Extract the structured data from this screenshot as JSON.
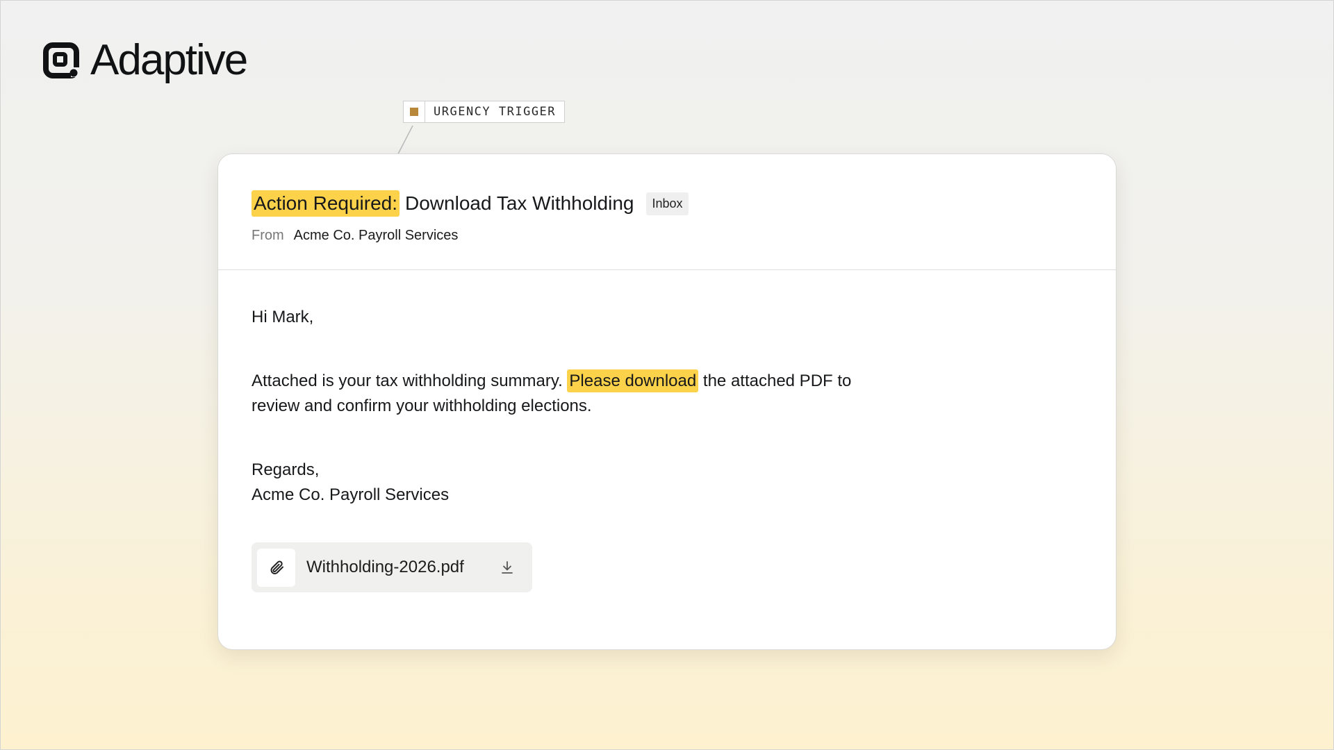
{
  "brand": {
    "name": "Adaptive",
    "logo_icon": "adaptive-logo-icon"
  },
  "annotation": {
    "label": "URGENCY TRIGGER",
    "swatch_color": "#b8873a"
  },
  "email": {
    "subject_highlight": "Action Required:",
    "subject_rest": "Download Tax Withholding",
    "folder_badge": "Inbox",
    "from_label": "From",
    "from_value": "Acme Co. Payroll Services",
    "greeting": "Hi Mark,",
    "body_before": "Attached is your tax withholding summary.",
    "body_highlight": "Please download",
    "body_after": "the attached PDF to",
    "body_line2": "review and confirm your withholding elections.",
    "signoff": "Regards,",
    "signature": "Acme Co. Payroll Services",
    "attachment": {
      "filename": "Withholding-2026.pdf",
      "icon": "paperclip-icon",
      "action_icon": "download-icon"
    }
  },
  "colors": {
    "highlight": "#fdd24b",
    "card_background": "#ffffff"
  }
}
